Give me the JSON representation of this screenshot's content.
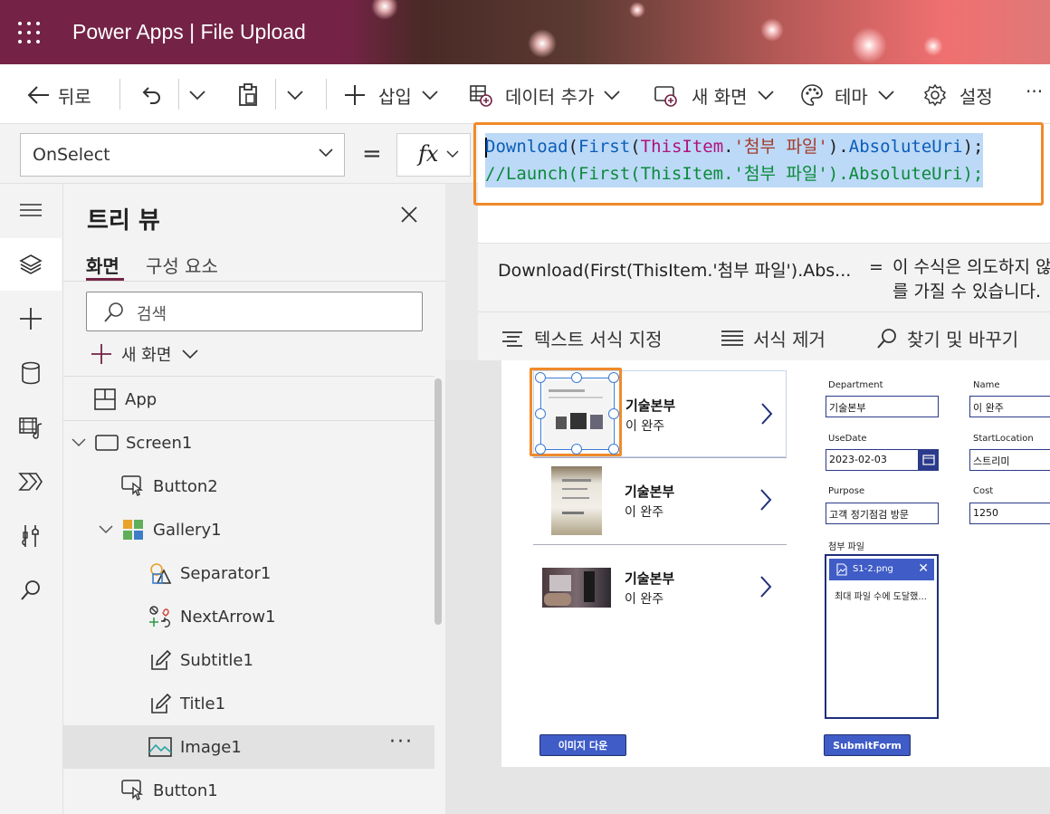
{
  "header": {
    "title": "Power Apps  |  File Upload"
  },
  "commandbar": {
    "back": "뒤로",
    "insert": "삽입",
    "add_data": "데이터 추가",
    "new_screen": "새 화면",
    "theme": "테마",
    "settings": "설정",
    "more": "···"
  },
  "formula": {
    "property": "OnSelect",
    "equals": "=",
    "fx": "fx",
    "line1": {
      "cursor_char": "D",
      "fn1": "ownload",
      "p1": "(",
      "fn2": "First",
      "p2": "(",
      "rec": "ThisItem",
      "p3": ".",
      "str": "'첨부 파일'",
      "p4": ").",
      "fn3": "AbsoluteUri",
      "p5": ");"
    },
    "line2": {
      "cmt": "//Launch(First(ThisItem.'첨부 파일').AbsoluteUri);"
    },
    "result_expr": "Download(First(ThisItem.'첨부 파일').Abs...",
    "result_eq": "=",
    "result_desc": "이 수식은 의도하지 않은 결과를 가질 수 있습니다."
  },
  "format": {
    "format_text": "텍스트 서식 지정",
    "remove_format": "서식 제거",
    "find_replace": "찾기 및 바꾸기"
  },
  "tree": {
    "title": "트리 뷰",
    "tabs": [
      "화면",
      "구성 요소"
    ],
    "search_placeholder": "검색",
    "new_screen": "새 화면",
    "items": [
      {
        "label": "App"
      },
      {
        "label": "Screen1"
      },
      {
        "label": "Button2"
      },
      {
        "label": "Gallery1"
      },
      {
        "label": "Separator1"
      },
      {
        "label": "NextArrow1"
      },
      {
        "label": "Subtitle1"
      },
      {
        "label": "Title1"
      },
      {
        "label": "Image1",
        "more": "···"
      },
      {
        "label": "Button1"
      }
    ]
  },
  "gallery": {
    "items": [
      {
        "title": "기술본부",
        "subtitle": "이 완주"
      },
      {
        "title": "기술본부",
        "subtitle": "이 완주"
      },
      {
        "title": "기술본부",
        "subtitle": "이 완주"
      }
    ],
    "button": "이미지 다운"
  },
  "form": {
    "department_label": "Department",
    "department_value": "기술본부",
    "name_label": "Name",
    "name_value": "이 완주",
    "usedate_label": "UseDate",
    "usedate_value": "2023-02-03",
    "startlocation_label": "StartLocation",
    "startlocation_value": "스트리미",
    "purpose_label": "Purpose",
    "purpose_value": "고객 정기점검 방문",
    "cost_label": "Cost",
    "cost_value": "1250",
    "attach_label": "첨부 파일",
    "attach_file": "S1-2.png",
    "attach_msg": "최대 파일 수에 도달했...",
    "submit": "SubmitForm"
  },
  "colors": {
    "header_plum": "#742346",
    "accent_orange": "#f08a2b",
    "form_blue": "#3f5cc7"
  }
}
